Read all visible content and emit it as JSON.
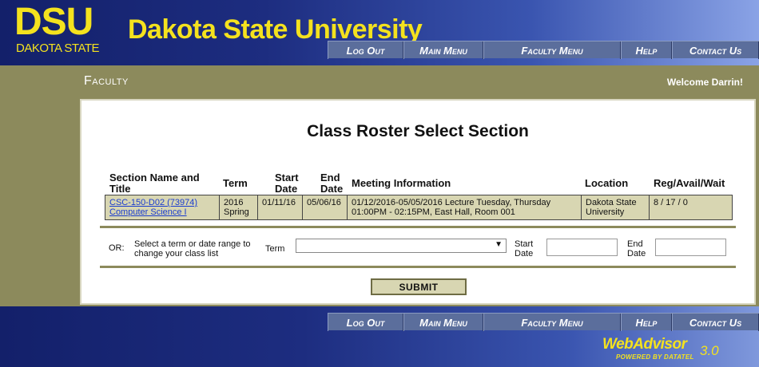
{
  "header": {
    "logo": "DSU",
    "logo_sub": "DAKOTA STATE",
    "title": "Dakota State University"
  },
  "nav": {
    "items": [
      "Log Out",
      "Main Menu",
      "Faculty Menu",
      "Help",
      "Contact Us"
    ]
  },
  "band": {
    "section": "Faculty",
    "welcome": "Welcome Darrin!"
  },
  "page": {
    "title": "Class Roster Select Section"
  },
  "table": {
    "columns": [
      "Section Name and Title",
      "Term",
      "Start Date",
      "End Date",
      "Meeting Information",
      "Location",
      "Reg/Avail/Wait"
    ],
    "row": {
      "section_code": "CSC-150-D02 (73974)",
      "section_title": "Computer Science I",
      "term_year": "2016",
      "term_season": "Spring",
      "start": "01/11/16",
      "end": "05/06/16",
      "meeting_line1": "01/12/2016-05/05/2016 Lecture Tuesday, Thursday",
      "meeting_line2": "01:00PM - 02:15PM, East Hall, Room 001",
      "location_line1": "Dakota State",
      "location_line2": "University",
      "reg": "8 / 17 / 0"
    }
  },
  "filter": {
    "or_label": "OR:",
    "instruction_line1": "Select a term or date range to",
    "instruction_line2": "change your class list",
    "term_label": "Term",
    "term_value": "",
    "start_label_1": "Start",
    "start_label_2": "Date",
    "end_label_1": "End",
    "end_label_2": "Date",
    "start_value": "",
    "end_value": ""
  },
  "submit_label": "SUBMIT",
  "footer": {
    "brand": "WebAdvisor",
    "version": "3.0",
    "powered": "POWERED BY DATATEL"
  }
}
